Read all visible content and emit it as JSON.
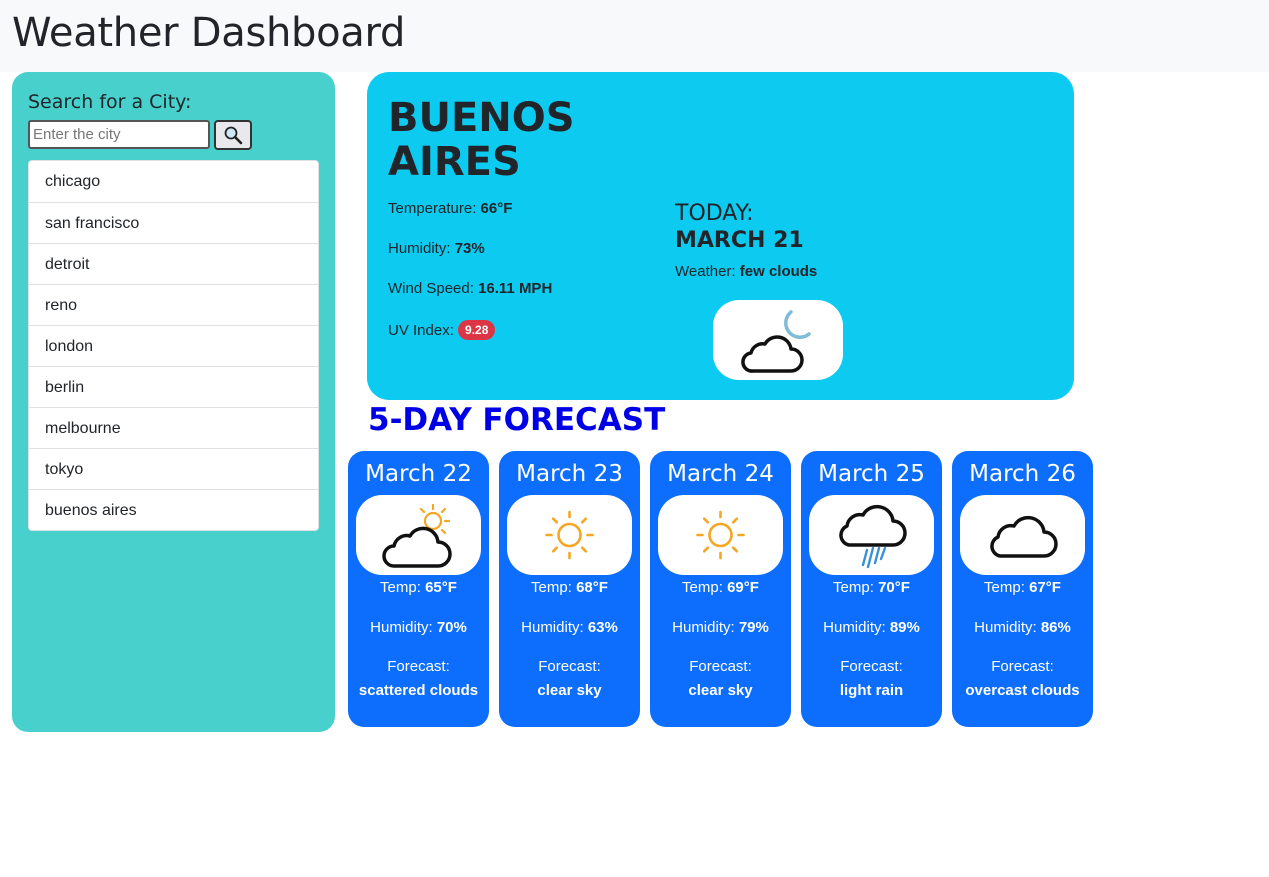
{
  "header": {
    "title": "Weather Dashboard"
  },
  "sidebar": {
    "search_label": "Search for a City:",
    "search_placeholder": "Enter the city",
    "search_value": "",
    "search_button_icon": "magnifier-icon",
    "cities": [
      "chicago",
      "san francisco",
      "detroit",
      "reno",
      "london",
      "berlin",
      "melbourne",
      "tokyo",
      "buenos aires"
    ]
  },
  "current": {
    "city": "BUENOS AIRES",
    "temperature_label": "Temperature:",
    "temperature": "66°F",
    "humidity_label": "Humidity:",
    "humidity": "73%",
    "wind_label": "Wind Speed:",
    "wind": "16.11 MPH",
    "uv_label": "UV Index:",
    "uv": "9.28",
    "today_label": "TODAY:",
    "today_date": "MARCH 21",
    "weather_label": "Weather:",
    "weather": "few clouds",
    "icon": "cloud-moon-icon"
  },
  "forecast": {
    "title": "5-DAY FORECAST",
    "temp_label": "Temp:",
    "humidity_label": "Humidity:",
    "forecast_label": "Forecast:",
    "days": [
      {
        "date": "March 22",
        "temp": "65°F",
        "humidity": "70%",
        "desc": "scattered clouds",
        "icon": "cloud-sun-icon"
      },
      {
        "date": "March 23",
        "temp": "68°F",
        "humidity": "63%",
        "desc": "clear sky",
        "icon": "sun-icon"
      },
      {
        "date": "March 24",
        "temp": "69°F",
        "humidity": "79%",
        "desc": "clear sky",
        "icon": "sun-icon"
      },
      {
        "date": "March 25",
        "temp": "70°F",
        "humidity": "89%",
        "desc": "light rain",
        "icon": "cloud-rain-icon"
      },
      {
        "date": "March 26",
        "temp": "67°F",
        "humidity": "86%",
        "desc": "overcast clouds",
        "icon": "cloud-icon"
      }
    ]
  },
  "colors": {
    "sidebar_bg": "#48d1cc",
    "current_bg": "#0dcaf0",
    "forecast_card_bg": "#0d6efd",
    "forecast_title": "#0000e6",
    "uv_badge": "#dc3545"
  }
}
